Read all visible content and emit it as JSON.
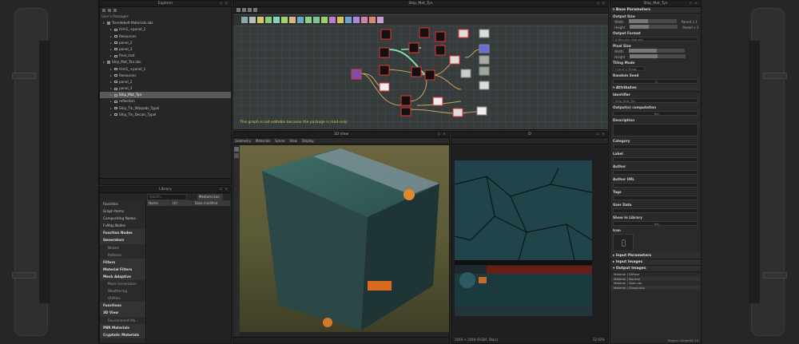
{
  "explorer": {
    "title": "Explorer",
    "header": "User's Packages",
    "items": [
      {
        "label": "Tcendebelt Materials.sbs",
        "level": 0,
        "kind": "package"
      },
      {
        "label": "trim1_+panel_1",
        "level": 1,
        "kind": "graph"
      },
      {
        "label": "Resources",
        "level": 1,
        "kind": "folder"
      },
      {
        "label": "panel_2",
        "level": 1,
        "kind": "graph"
      },
      {
        "label": "panel_3",
        "level": 1,
        "kind": "graph"
      },
      {
        "label": "final_mat",
        "level": 1,
        "kind": "graph"
      },
      {
        "label": "Ship_Mat_Tan.sbs",
        "level": 0,
        "kind": "package"
      },
      {
        "label": "trim1_+panel_1",
        "level": 1,
        "kind": "graph"
      },
      {
        "label": "Resources",
        "level": 1,
        "kind": "folder"
      },
      {
        "label": "panel_2",
        "level": 1,
        "kind": "graph"
      },
      {
        "label": "panel_3",
        "level": 1,
        "kind": "graph"
      },
      {
        "label": "Ship_Mat_Tyn",
        "level": 1,
        "kind": "graph",
        "selected": true
      },
      {
        "label": "reflection",
        "level": 1,
        "kind": "graph"
      },
      {
        "label": "Ship_Tin_Winpods_Typel",
        "level": 1,
        "kind": "graph"
      },
      {
        "label": "Ship_Tin_Decals_Typel",
        "level": 1,
        "kind": "graph"
      }
    ]
  },
  "library": {
    "title": "Library",
    "search_placeholder": "Search...",
    "filter_label": "Medium Icon",
    "columns": [
      "Name",
      "Url",
      "Data modified"
    ],
    "categories": [
      {
        "label": "Favorites",
        "type": "item"
      },
      {
        "label": "Graph Items",
        "type": "item"
      },
      {
        "label": "Compositing Nodes",
        "type": "item"
      },
      {
        "label": "FxMap Nodes",
        "type": "item"
      },
      {
        "label": "Function Nodes",
        "type": "header"
      },
      {
        "label": "Generators",
        "type": "header"
      },
      {
        "label": "Noises",
        "type": "sub"
      },
      {
        "label": "Patterns",
        "type": "sub"
      },
      {
        "label": "Filters",
        "type": "header"
      },
      {
        "label": "Material Filters",
        "type": "header"
      },
      {
        "label": "Mesh Adaptive",
        "type": "header"
      },
      {
        "label": "Mask Generators",
        "type": "sub"
      },
      {
        "label": "Weathering",
        "type": "sub"
      },
      {
        "label": "Utilities",
        "type": "sub"
      },
      {
        "label": "Functions",
        "type": "header"
      },
      {
        "label": "3D View",
        "type": "header"
      },
      {
        "label": "Environment Ma...",
        "type": "sub"
      },
      {
        "label": "PBR Materials",
        "type": "header"
      },
      {
        "label": "Cryptatic Materials",
        "type": "header"
      }
    ]
  },
  "graph": {
    "title": "Ship_Mat_Tyn",
    "note": "This graph is not editable because the package is read-only"
  },
  "view3d": {
    "title": "3D View",
    "menu": [
      "Geometry",
      "Materials",
      "Scene",
      "View",
      "Display"
    ]
  },
  "view2d": {
    "title": "D",
    "status": "2048 × 2048 (RGBA, 8bpc)",
    "zoom": "22.92%"
  },
  "props": {
    "title": "Ship_Mat_Tyn",
    "base_parameters": "Base Parameters",
    "output_size": "Output Size",
    "width_label": "Width",
    "height_label": "Height",
    "parent_x1": "Parent x 1",
    "output_format": "Output Format",
    "output_format_value": "8 Bits per channel",
    "pixel_size": "Pixel Size",
    "pixel_w": "Width",
    "pixel_h": "Height",
    "tiling_mode": "Tiling Mode",
    "tiling_value": "H and V Tiling",
    "random_seed": "Random Seed",
    "random_value": "0",
    "attributes": "Attributes",
    "identifier": "Identifier",
    "identifier_value": "Ship_Mat_Tyn",
    "output_comp": "Output(s) computation",
    "output_comp_value": "Yes",
    "description": "Description",
    "category": "Category",
    "label": "Label",
    "author": "Author",
    "author_url": "Author URL",
    "tags": "Tags",
    "user_data": "User Data",
    "show_in_library": "Show In Library",
    "show_value": "Yes",
    "icon": "Icon",
    "input_parameters": "Input Parameters",
    "input_images": "Input Images",
    "output_images": "Output Images",
    "outputs": [
      "Material | Diffuse",
      "Material | Normal",
      "Material | Specular",
      "Material | Glossiness"
    ],
    "engine": "Engine: Direct3D 10"
  },
  "colors": {
    "accent_node_link": "#7ee0a8",
    "graph_note": "#d8c848",
    "selected_row": "#5a5a5a"
  }
}
